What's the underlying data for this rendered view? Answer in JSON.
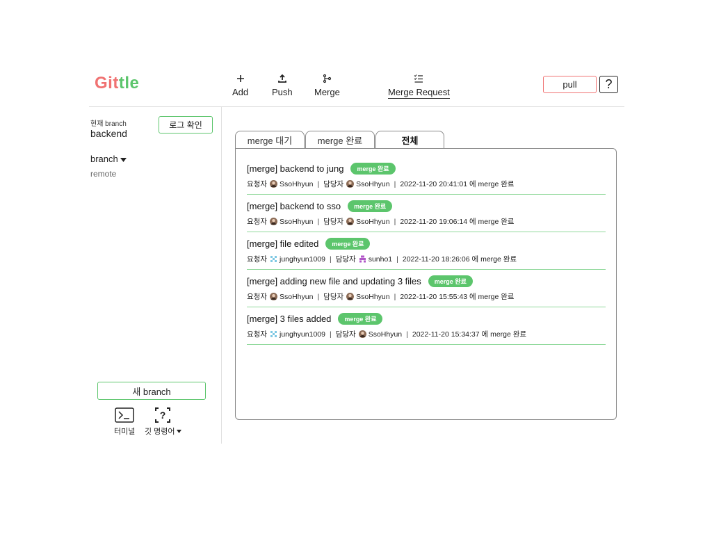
{
  "app": {
    "logo": {
      "part1": "Git",
      "part2": "tle"
    },
    "toolbar": [
      {
        "key": "add",
        "label": "Add",
        "icon": "plus-icon"
      },
      {
        "key": "push",
        "label": "Push",
        "icon": "upload-icon"
      },
      {
        "key": "merge",
        "label": "Merge",
        "icon": "branch-merge-icon"
      },
      {
        "key": "merge_request",
        "label": "Merge Request",
        "icon": "checklist-icon",
        "active": true
      }
    ],
    "pull_label": "pull",
    "help_label": "?"
  },
  "sidebar": {
    "current_label": "현재 branch",
    "current_branch": "backend",
    "log_button": "로그 확인",
    "branch_dropdown": "branch",
    "remote_label": "remote",
    "new_branch_button": "새 branch",
    "terminal_label": "터미널",
    "git_command_label": "깃 명령어"
  },
  "tabs": [
    {
      "label": "merge 대기"
    },
    {
      "label": "merge 완료"
    },
    {
      "label": "전체",
      "active": true
    }
  ],
  "merge_requests": [
    {
      "title": "[merge] backend to jung",
      "badge": "merge 완료",
      "requester_label": "요청자",
      "requester": "SsoHhyun",
      "requester_avatar": "user-photo-avatar",
      "assignee_label": "담당자",
      "assignee": "SsoHhyun",
      "assignee_avatar": "user-photo-avatar",
      "time": "2022-11-20 20:41:01 에 merge 완료"
    },
    {
      "title": "[merge] backend to sso",
      "badge": "merge 완료",
      "requester_label": "요청자",
      "requester": "SsoHhyun",
      "requester_avatar": "user-photo-avatar",
      "assignee_label": "담당자",
      "assignee": "SsoHhyun",
      "assignee_avatar": "user-photo-avatar",
      "time": "2022-11-20 19:06:14 에 merge 완료"
    },
    {
      "title": "[merge] file edited",
      "badge": "merge 완료",
      "requester_label": "요청자",
      "requester": "junghyun1009",
      "requester_avatar": "identicon-blue-avatar",
      "assignee_label": "담당자",
      "assignee": "sunho1",
      "assignee_avatar": "identicon-purple-avatar",
      "time": "2022-11-20 18:26:06 에 merge 완료"
    },
    {
      "title": "[merge] adding new file and updating 3 files",
      "badge": "merge 완료",
      "requester_label": "요청자",
      "requester": "SsoHhyun",
      "requester_avatar": "user-photo-avatar",
      "assignee_label": "담당자",
      "assignee": "SsoHhyun",
      "assignee_avatar": "user-photo-avatar",
      "time": "2022-11-20 15:55:43 에 merge 완료"
    },
    {
      "title": "[merge] 3 files added",
      "badge": "merge 완료",
      "requester_label": "요청자",
      "requester": "junghyun1009",
      "requester_avatar": "identicon-blue-avatar",
      "assignee_label": "담당자",
      "assignee": "SsoHhyun",
      "assignee_avatar": "user-photo-avatar",
      "time": "2022-11-20 15:34:37 에 merge 완료"
    }
  ],
  "colors": {
    "logo_red": "#f07272",
    "accent_green": "#5cc56c",
    "divider_green": "#8fd89a"
  }
}
